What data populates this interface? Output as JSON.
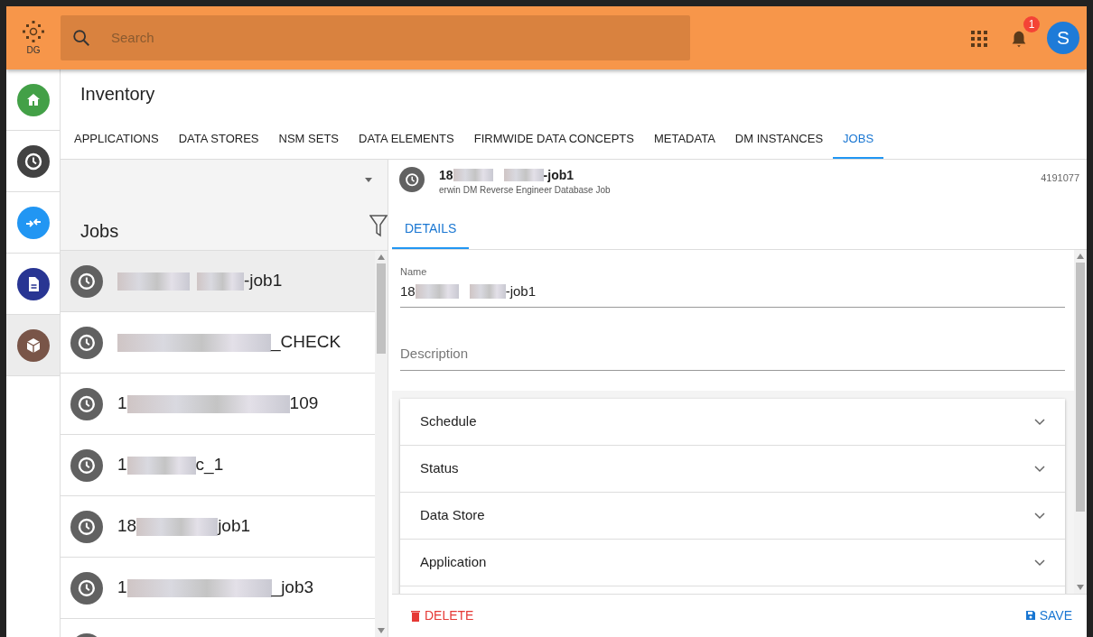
{
  "app": {
    "logo_text": "DG"
  },
  "search": {
    "placeholder": "Search"
  },
  "notifications": {
    "count": "1"
  },
  "user": {
    "initial": "S"
  },
  "rail": [
    {
      "kind": "home",
      "color": "#43a047",
      "selected": false
    },
    {
      "kind": "clock",
      "color": "#424242",
      "selected": false
    },
    {
      "kind": "arrows",
      "color": "#2196f3",
      "selected": false
    },
    {
      "kind": "doc",
      "color": "#283593",
      "selected": false
    },
    {
      "kind": "box",
      "color": "#795548",
      "selected": true
    }
  ],
  "page_title": "Inventory",
  "tabs": [
    {
      "label": "APPLICATIONS",
      "selected": false
    },
    {
      "label": "DATA STORES",
      "selected": false
    },
    {
      "label": "NSM SETS",
      "selected": false
    },
    {
      "label": "DATA ELEMENTS",
      "selected": false
    },
    {
      "label": "FIRMWIDE DATA CONCEPTS",
      "selected": false
    },
    {
      "label": "METADATA",
      "selected": false
    },
    {
      "label": "DM INSTANCES",
      "selected": false
    },
    {
      "label": "JOBS",
      "selected": true
    }
  ],
  "list": {
    "title": "Jobs",
    "items": [
      {
        "suffix": "-job1",
        "selected": true
      },
      {
        "suffix": "_CHECK",
        "selected": false
      },
      {
        "prefix": "1",
        "suffix": "109",
        "selected": false
      },
      {
        "prefix": "1",
        "suffix": "c_1",
        "selected": false
      },
      {
        "prefix": "18",
        "suffix": "job1",
        "selected": false
      },
      {
        "prefix": "1",
        "suffix": "_job3",
        "selected": false
      }
    ]
  },
  "detail": {
    "title_prefix": "18",
    "title_suffix": "-job1",
    "subtitle": "erwin DM Reverse Engineer Database Job",
    "id": "4191077",
    "tabs": [
      {
        "label": "DETAILS",
        "selected": true
      }
    ],
    "fields": [
      {
        "label": "Name",
        "value_prefix": "18",
        "value_suffix": "-job1"
      },
      {
        "placeholder": "Description"
      }
    ],
    "sections": [
      {
        "label": "Schedule",
        "expanded": false
      },
      {
        "label": "Status",
        "expanded": false
      },
      {
        "label": "Data Store",
        "expanded": false
      },
      {
        "label": "Application",
        "expanded": false
      }
    ],
    "actions": [
      {
        "kind": "delete",
        "label": "DELETE"
      },
      {
        "kind": "save",
        "label": "SAVE"
      }
    ]
  }
}
